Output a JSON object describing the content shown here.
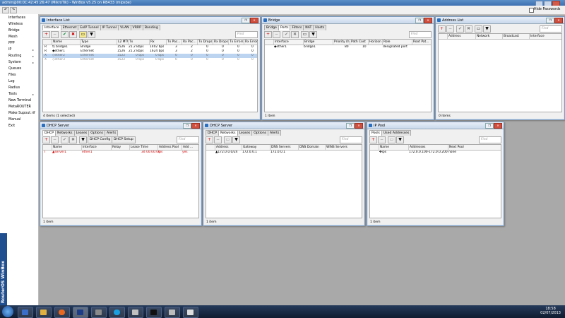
{
  "titlebar": {
    "title": "admin@00:0C:42:45:26:47 (MikroTik) - WinBox v5.25 on RB433 (mipsbe)",
    "hide_passwords": "Hide Passwords"
  },
  "sidebar": {
    "items": [
      "Interfaces",
      "Wireless",
      "Bridge",
      "Mesh",
      "PPP",
      "IP",
      "Routing",
      "System",
      "Queues",
      "Files",
      "Log",
      "Radius",
      "Tools",
      "New Terminal",
      "MetaROUTER",
      "Make Supout.rif",
      "Manual",
      "Exit"
    ],
    "vertical_label": "RouterOS WinBox"
  },
  "interface_list": {
    "title": "Interface List",
    "tabs": [
      "Interface",
      "Ethernet",
      "EoIP Tunnel",
      "IP Tunnel",
      "VLAN",
      "VRRP",
      "Bonding"
    ],
    "find": "Find",
    "columns": [
      "Name",
      "Type",
      "L2 MTU",
      "Tx",
      "Rx",
      "Tx Pac...",
      "Rx Pac...",
      "Tx Drops",
      "Rx Drops",
      "Tx Errors",
      "Rx Errors"
    ],
    "rows": [
      {
        "flag": "R",
        "name": "bridge1",
        "type": "Bridge",
        "l2mtu": "1526",
        "tx": "21.2 kbps",
        "rx": "1402 bps",
        "txp": "3",
        "rxp": "2",
        "txd": "0",
        "rxd": "0",
        "txe": "0",
        "rxe": "0"
      },
      {
        "flag": "R",
        "name": "ether1",
        "type": "Ethernet",
        "l2mtu": "1526",
        "tx": "21.2 kbps",
        "rx": "1624 bps",
        "txp": "3",
        "rxp": "2",
        "txd": "0",
        "rxd": "0",
        "txe": "0",
        "rxe": "0"
      },
      {
        "flag": "X",
        "name": "ether2",
        "type": "Ethernet",
        "l2mtu": "1522",
        "tx": "0 bps",
        "rx": "0 bps",
        "txp": "0",
        "rxp": "0",
        "txd": "0",
        "rxd": "0",
        "txe": "0",
        "rxe": "0"
      },
      {
        "flag": "X",
        "name": "ether3",
        "type": "Ethernet",
        "l2mtu": "1522",
        "tx": "0 bps",
        "rx": "0 bps",
        "txp": "0",
        "rxp": "0",
        "txd": "0",
        "rxd": "0",
        "txe": "0",
        "rxe": "0"
      }
    ],
    "status": "4 items (1 selected)"
  },
  "bridge": {
    "title": "Bridge",
    "tabs": [
      "Bridge",
      "Ports",
      "Filters",
      "NAT",
      "Hosts"
    ],
    "find": "Find",
    "columns": [
      "Interface",
      "Bridge",
      "Priority (h...",
      "Path Cost",
      "Horizon",
      "Role",
      "Root Pat..."
    ],
    "rows": [
      {
        "interface": "ether1",
        "bridge": "bridge1",
        "priority": "80",
        "cost": "10",
        "horizon": "",
        "role": "designated port",
        "root": ""
      }
    ],
    "status": "1 item"
  },
  "address_list": {
    "title": "Address List",
    "find": "Find",
    "columns": [
      "Address",
      "Network",
      "Broadcast",
      "Interface"
    ],
    "status": "0 items"
  },
  "dhcp_server": {
    "title": "DHCP Server",
    "tabs": [
      "DHCP",
      "Networks",
      "Leases",
      "Options",
      "Alerts"
    ],
    "config_button": "DHCP Config",
    "setup_button": "DHCP Setup",
    "find": "Find",
    "columns": [
      "Name",
      "Interface",
      "Relay",
      "Lease Time",
      "Address Pool",
      "Add ..."
    ],
    "rows": [
      {
        "name": "server1",
        "interface": "ether1",
        "relay": "",
        "lease": "3d 00:00:00",
        "pool": "ips",
        "add": "yes"
      }
    ],
    "status": "1 item"
  },
  "dhcp_networks": {
    "title": "DHCP Server",
    "tabs": [
      "DHCP",
      "Networks",
      "Leases",
      "Options",
      "Alerts"
    ],
    "find": "Find",
    "columns": [
      "Address",
      "Gateway",
      "DNS Servers",
      "DNS Domain",
      "WINS Servers"
    ],
    "rows": [
      {
        "address": "172.0.0.0/24",
        "gateway": "172.0.0.1",
        "dns": "172.0.0.1",
        "domain": "",
        "wins": ""
      }
    ],
    "status": "1 item"
  },
  "ip_pool": {
    "title": "IP Pool",
    "tabs": [
      "Pools",
      "Used Addresses"
    ],
    "find": "Find",
    "columns": [
      "Name",
      "Addresses",
      "Next Pool"
    ],
    "rows": [
      {
        "name": "ips",
        "addresses": "172.0.0.100-172.0.0.200",
        "next": "none"
      }
    ],
    "status": "1 item"
  },
  "taskbar": {
    "time": "18:58",
    "date": "02/07/2013"
  },
  "colors": {
    "selected_row": "#bcd4f0",
    "disabled_text": "#8a8a8a",
    "dhcp_row_text": "#d00000"
  }
}
